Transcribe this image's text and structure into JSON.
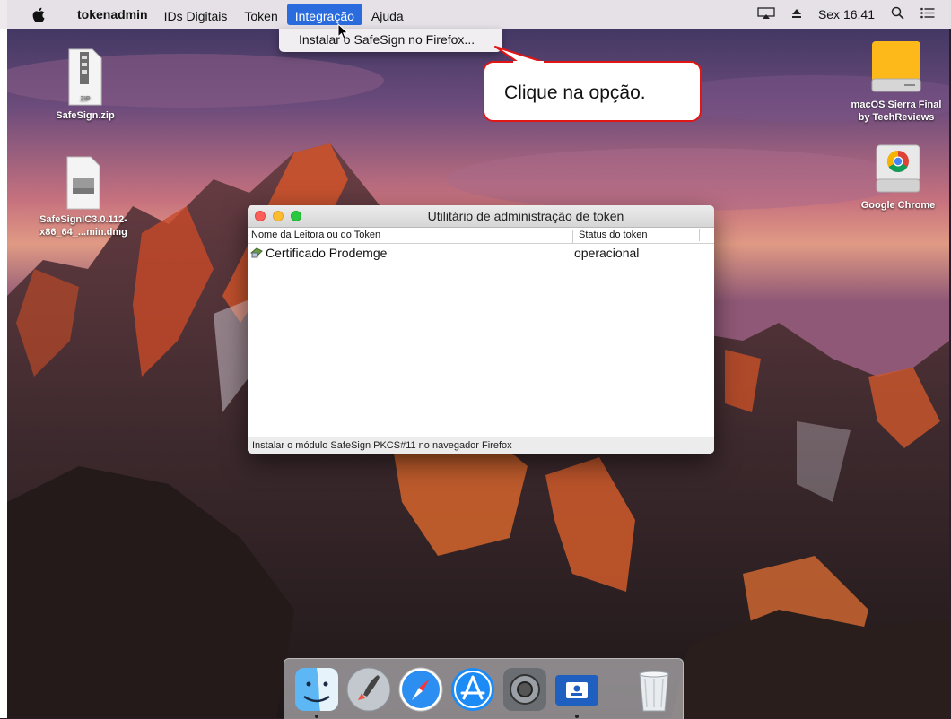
{
  "menubar": {
    "app_name": "tokenadmin",
    "items": [
      "IDs Digitais",
      "Token",
      "Integração",
      "Ajuda"
    ],
    "active_item": "Integração",
    "clock": "Sex 16:41"
  },
  "dropdown": {
    "items": [
      "Instalar o SafeSign no Firefox..."
    ]
  },
  "callout": {
    "text": "Clique na opção."
  },
  "desktop_icons": {
    "zip": {
      "label": "SafeSign.zip",
      "badge": "ZIP"
    },
    "dmg": {
      "label_line1": "SafeSignIC3.0.112-",
      "label_line2": "x86_64_...min.dmg"
    },
    "drive_sierra": {
      "label_line1": "macOS Sierra Final",
      "label_line2": "by TechReviews"
    },
    "chrome": {
      "label": "Google Chrome"
    }
  },
  "window": {
    "title": "Utilitário de administração de token",
    "columns": [
      "Nome da Leitora ou do Token",
      "Status do token"
    ],
    "rows": [
      {
        "name": "Certificado Prodemge",
        "status": "operacional"
      }
    ],
    "statusbar": "Instalar o módulo SafeSign PKCS#11 no navegador Firefox"
  },
  "dock": {
    "apps": [
      "finder",
      "launchpad",
      "safari",
      "app-store",
      "system-preferences",
      "tokenadmin",
      "trash"
    ]
  },
  "colors": {
    "menu_highlight": "#2a6cde",
    "callout_border": "#e01515"
  }
}
